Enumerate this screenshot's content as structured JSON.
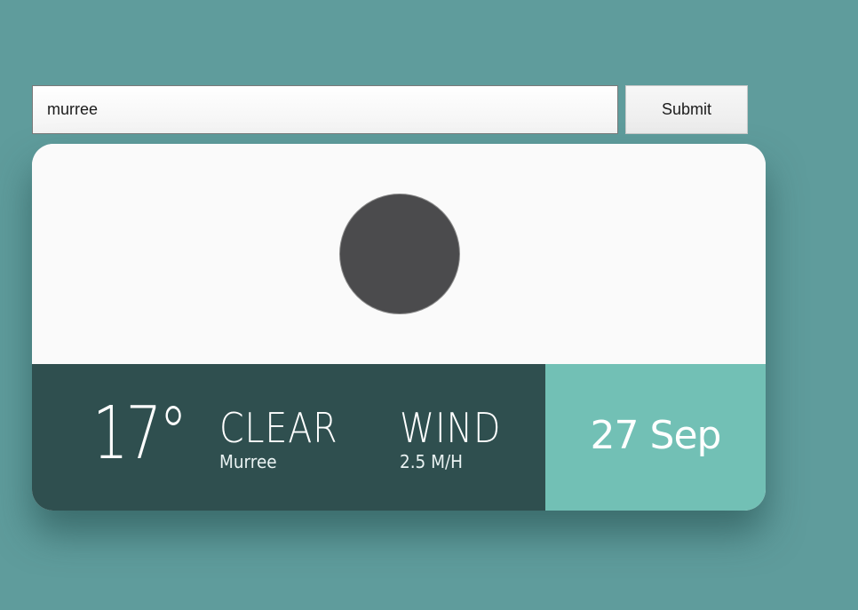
{
  "search": {
    "value": "murree",
    "submit_label": "Submit"
  },
  "weather": {
    "icon": "weather-condition-icon",
    "temperature": "17°",
    "condition": "CLEAR",
    "location": "Murree",
    "wind_label": "WIND",
    "wind_speed": "2.5 M/H",
    "date": "27 Sep"
  },
  "colors": {
    "page_background": "#5f9c9c",
    "card_background": "#fafafa",
    "info_bar": "#2f4f4f",
    "date_panel": "#72c0b5",
    "icon": "#4b4b4d"
  }
}
